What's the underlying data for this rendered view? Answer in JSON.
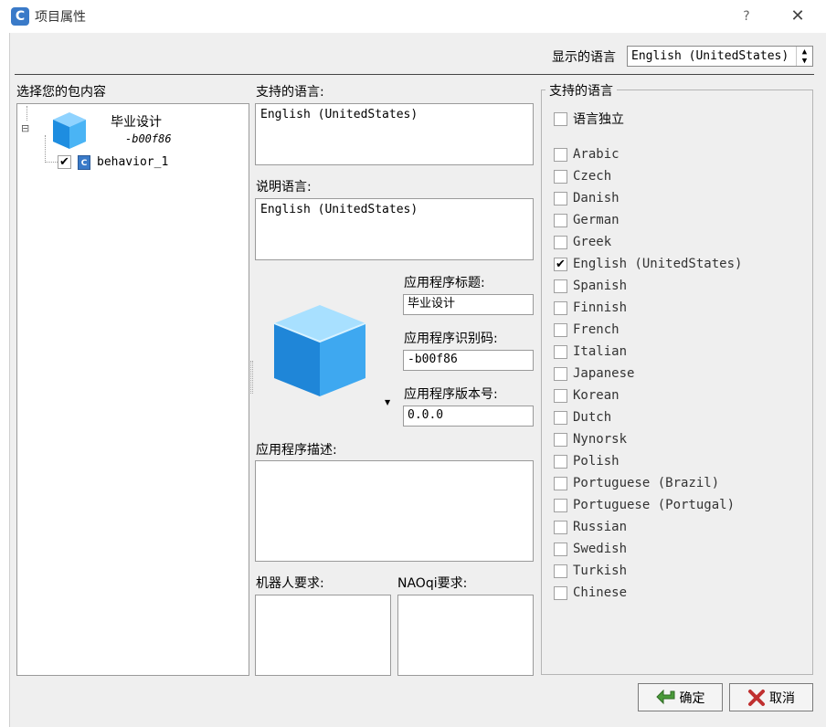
{
  "window": {
    "title": "项目属性",
    "help_label": "?",
    "close_label": "✕",
    "icon_letter": "C"
  },
  "display_language": {
    "label": "显示的语言",
    "value": "English (UnitedStates)"
  },
  "package": {
    "label": "选择您的包内容",
    "project_name": "毕业设计",
    "project_id": "-b00f86",
    "expander": "⊟",
    "child": {
      "name": "behavior_1",
      "checked": true
    }
  },
  "supported_languages_box": {
    "label": "支持的语言:",
    "value": "English (UnitedStates)"
  },
  "description_language": {
    "label": "说明语言:",
    "value": "English (UnitedStates)"
  },
  "app": {
    "title_label": "应用程序标题:",
    "title_value": "毕业设计",
    "id_label": "应用程序识别码:",
    "id_value": "-b00f86",
    "version_label": "应用程序版本号:",
    "version_value": "0.0.0",
    "description_label": "应用程序描述:",
    "description_value": "",
    "robot_req_label": "机器人要求:",
    "naoqi_req_label": "NAOqi要求:",
    "icon_dropdown": "▼"
  },
  "languages_panel": {
    "title": "支持的语言",
    "independent": {
      "label": "语言独立",
      "checked": false
    },
    "items": [
      {
        "label": "Arabic",
        "checked": false
      },
      {
        "label": "Czech",
        "checked": false
      },
      {
        "label": "Danish",
        "checked": false
      },
      {
        "label": "German",
        "checked": false
      },
      {
        "label": "Greek",
        "checked": false
      },
      {
        "label": "English (UnitedStates)",
        "checked": true
      },
      {
        "label": "Spanish",
        "checked": false
      },
      {
        "label": "Finnish",
        "checked": false
      },
      {
        "label": "French",
        "checked": false
      },
      {
        "label": "Italian",
        "checked": false
      },
      {
        "label": "Japanese",
        "checked": false
      },
      {
        "label": "Korean",
        "checked": false
      },
      {
        "label": "Dutch",
        "checked": false
      },
      {
        "label": "Nynorsk",
        "checked": false
      },
      {
        "label": "Polish",
        "checked": false
      },
      {
        "label": "Portuguese (Brazil)",
        "checked": false
      },
      {
        "label": "Portuguese (Portugal)",
        "checked": false
      },
      {
        "label": "Russian",
        "checked": false
      },
      {
        "label": "Swedish",
        "checked": false
      },
      {
        "label": "Turkish",
        "checked": false
      },
      {
        "label": "Chinese",
        "checked": false
      }
    ]
  },
  "buttons": {
    "ok": "确定",
    "cancel": "取消"
  },
  "colors": {
    "accent": "#3a7ac8",
    "cube": "#2aa0ec",
    "ok_arrow": "#4a9a3a",
    "cancel_x": "#c03030"
  }
}
